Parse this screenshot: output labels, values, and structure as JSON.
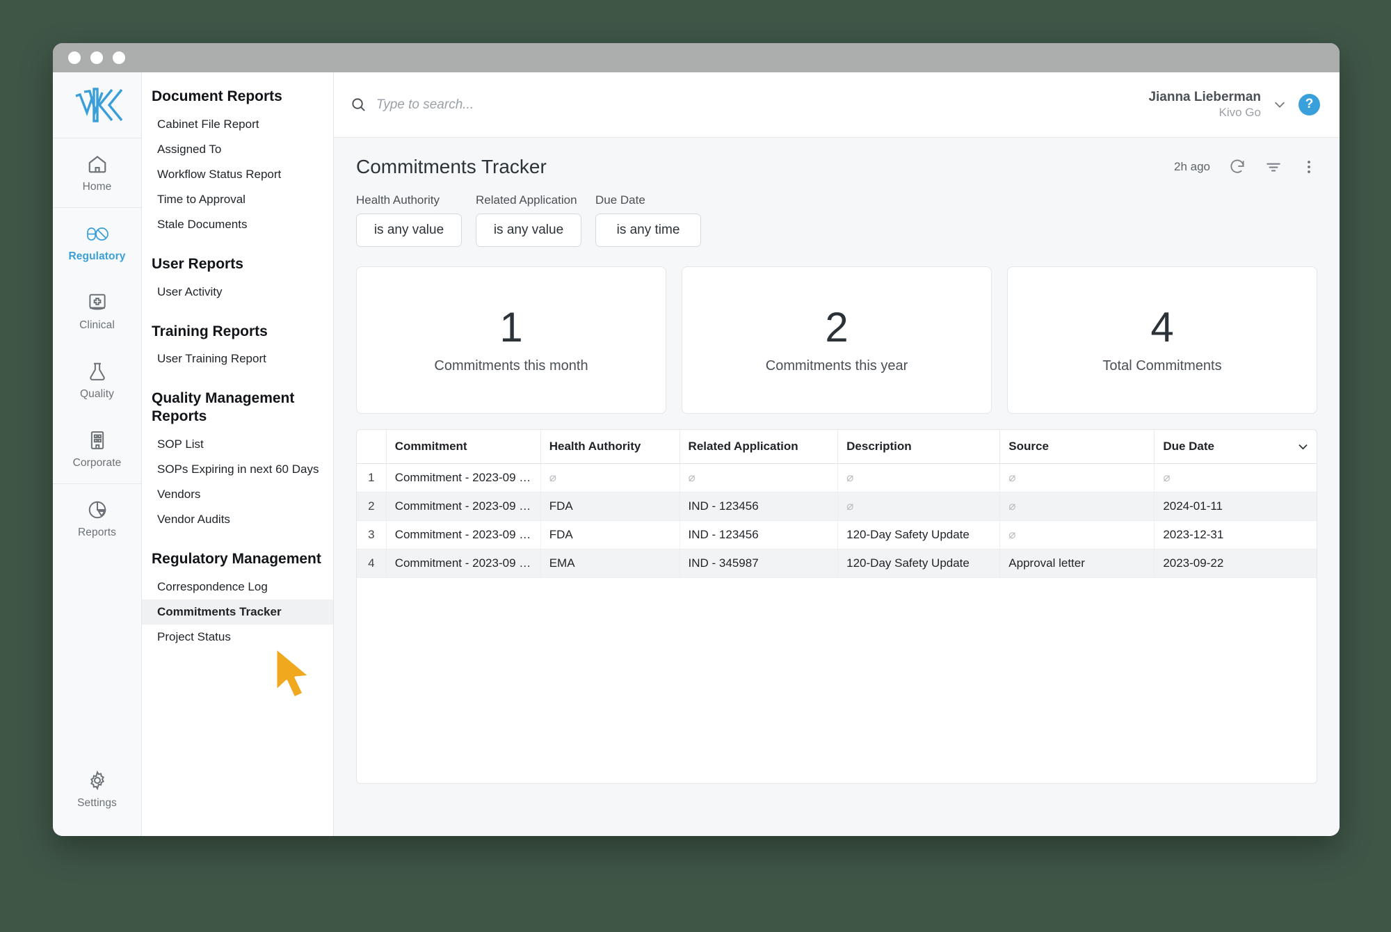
{
  "window": {
    "traffic_lights": [
      "close",
      "minimize",
      "maximize"
    ]
  },
  "rail": {
    "logo_name": "kivo-logo",
    "items": [
      {
        "label": "Home",
        "icon": "home-icon",
        "active": false
      },
      {
        "label": "Regulatory",
        "icon": "pill-icon",
        "active": true
      },
      {
        "label": "Clinical",
        "icon": "medical-book-icon",
        "active": false
      },
      {
        "label": "Quality",
        "icon": "flask-icon",
        "active": false
      },
      {
        "label": "Corporate",
        "icon": "building-icon",
        "active": false
      },
      {
        "label": "Reports",
        "icon": "pie-chart-icon",
        "active": false
      },
      {
        "label": "Settings",
        "icon": "gear-icon",
        "active": false
      }
    ]
  },
  "search": {
    "placeholder": "Type to search...",
    "icon": "search-icon"
  },
  "user": {
    "name": "Jianna Lieberman",
    "org": "Kivo Go",
    "chevron_icon": "chevron-down-icon",
    "help_label": "?"
  },
  "reports_panel": {
    "groups": [
      {
        "title": "Document Reports",
        "items": [
          {
            "label": "Cabinet File Report",
            "selected": false
          },
          {
            "label": "Assigned To",
            "selected": false
          },
          {
            "label": "Workflow Status Report",
            "selected": false
          },
          {
            "label": "Time to Approval",
            "selected": false
          },
          {
            "label": "Stale Documents",
            "selected": false
          }
        ]
      },
      {
        "title": "User Reports",
        "items": [
          {
            "label": "User Activity",
            "selected": false
          }
        ]
      },
      {
        "title": "Training Reports",
        "items": [
          {
            "label": "User Training Report",
            "selected": false
          }
        ]
      },
      {
        "title": "Quality Management Reports",
        "items": [
          {
            "label": "SOP List",
            "selected": false
          },
          {
            "label": "SOPs Expiring in next 60 Days",
            "selected": false
          },
          {
            "label": "Vendors",
            "selected": false
          },
          {
            "label": "Vendor Audits",
            "selected": false
          }
        ]
      },
      {
        "title": "Regulatory Management",
        "items": [
          {
            "label": "Correspondence Log",
            "selected": false
          },
          {
            "label": "Commitments Tracker",
            "selected": true
          },
          {
            "label": "Project Status",
            "selected": false
          }
        ]
      }
    ]
  },
  "page": {
    "title": "Commitments Tracker",
    "last_updated": "2h ago",
    "toolbar_icons": [
      "refresh-icon",
      "filter-icon",
      "more-vertical-icon"
    ]
  },
  "filters": [
    {
      "label": "Health Authority",
      "value": "is any value"
    },
    {
      "label": "Related Application",
      "value": "is any value"
    },
    {
      "label": "Due Date",
      "value": "is any time"
    }
  ],
  "kpis": [
    {
      "value": "1",
      "label": "Commitments this month"
    },
    {
      "value": "2",
      "label": "Commitments this year"
    },
    {
      "value": "4",
      "label": "Total Commitments"
    }
  ],
  "table": {
    "columns": [
      "",
      "Commitment",
      "Health Authority",
      "Related Application",
      "Description",
      "Source",
      "Due Date"
    ],
    "sorted_column": "Due Date",
    "sort_icon": "chevron-down-icon",
    "null_glyph": "⌀",
    "rows": [
      {
        "index": "1",
        "commitment": "Commitment - 2023-09 …",
        "health_authority": "",
        "related_application": "",
        "description": "",
        "source": "",
        "due_date": ""
      },
      {
        "index": "2",
        "commitment": "Commitment - 2023-09 …",
        "health_authority": "FDA",
        "related_application": "IND - 123456",
        "description": "",
        "source": "",
        "due_date": "2024-01-11"
      },
      {
        "index": "3",
        "commitment": "Commitment - 2023-09 …",
        "health_authority": "FDA",
        "related_application": "IND - 123456",
        "description": "120-Day Safety Update",
        "source": "",
        "due_date": "2023-12-31"
      },
      {
        "index": "4",
        "commitment": "Commitment - 2023-09 …",
        "health_authority": "EMA",
        "related_application": "IND - 345987",
        "description": "120-Day Safety Update",
        "source": "Approval letter",
        "due_date": "2023-09-22"
      }
    ]
  },
  "colors": {
    "accent": "#3a9fd8",
    "desktop": "#3f5647",
    "cursor": "#f0a81e",
    "selected_row_bg": "#f2f3f4"
  },
  "cursor": {
    "icon": "mouse-pointer-icon"
  }
}
